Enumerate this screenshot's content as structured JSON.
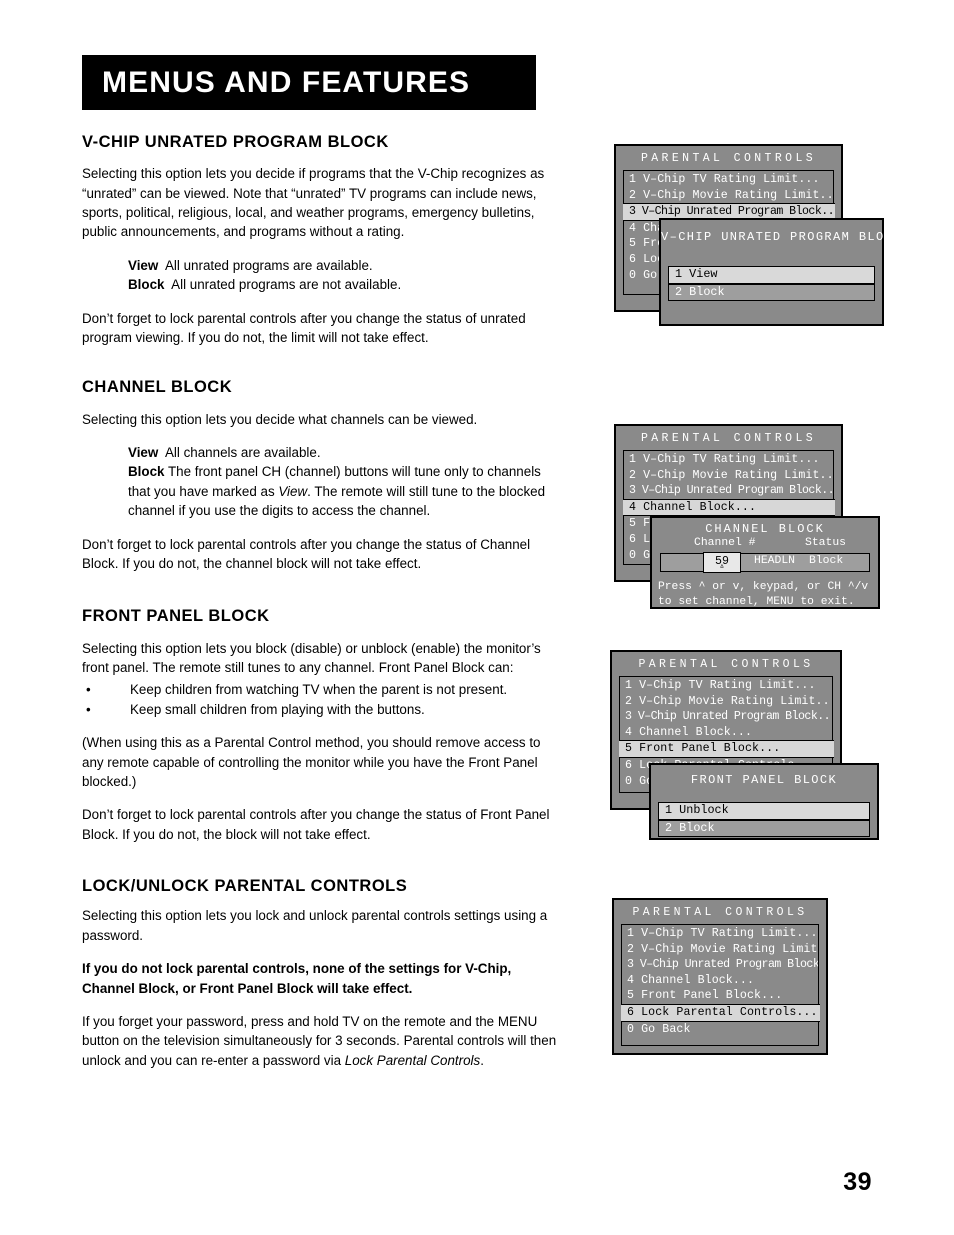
{
  "page": {
    "banner_title": "MENUS AND FEATURES",
    "page_number": "39"
  },
  "sections": [
    {
      "id": "vchip-unrated",
      "title": "V-CHIP UNRATED PROGRAM BLOCK",
      "p1": "Selecting this option lets you decide if programs that the V-Chip recognizes as “unrated” can be viewed. Note that “unrated” TV programs can include news, sports, political, religious, local, and weather programs, emergency bulletins, public announcements, and programs without a rating.",
      "view_lead": "View",
      "view_text": "All unrated programs are available.",
      "block_lead": "Block",
      "block_text": "All unrated programs are not available.",
      "p2": "Don’t forget to lock parental controls after you change the status of unrated program viewing. If you do not, the limit will not take effect."
    },
    {
      "id": "channel-block",
      "title": "CHANNEL BLOCK",
      "p1": "Selecting this option lets you decide what channels can be viewed.",
      "view_lead": "View",
      "view_text": "All channels are available.",
      "block_lead": "Block",
      "block_text_a": "The front panel CH (channel) buttons will tune only to channels that you have marked as ",
      "block_text_italic": "View",
      "block_text_b": ". The remote will still tune to the blocked channel if you use the digits to access the channel.",
      "p2": "Don’t forget to lock parental controls after you change the status of Channel Block. If you do not, the channel block will not take effect."
    },
    {
      "id": "front-panel-block",
      "title": "FRONT PANEL BLOCK",
      "p1": "Selecting this option lets you block (disable) or unblock (enable) the monitor’s front panel. The remote still tunes to any channel. Front Panel Block can:",
      "bullets": [
        "Keep children from watching TV when the parent is not present.",
        "Keep small children from playing with the buttons."
      ],
      "p2": "(When using this as a Parental Control method, you should remove access to any remote capable of controlling the monitor while you have the Front Panel blocked.)",
      "p3": "Don’t forget to lock parental controls after you change the status of Front Panel Block. If you do not, the block will not take effect."
    },
    {
      "id": "lock-unlock",
      "title": "LOCK/UNLOCK PARENTAL CONTROLS",
      "p1": "Selecting this option lets you lock and unlock parental controls settings using a password.",
      "p2_bold": "If you do not lock parental controls, none of the settings for V-Chip, Channel Block, or Front Panel Block will take effect.",
      "p3_a": "If you forget your password, press and hold TV on the remote and the MENU button on the television simultaneously for 3 seconds. Parental controls will then unlock and you can re-enter a password via ",
      "p3_italic": "Lock Parental Controls",
      "p3_b": "."
    }
  ],
  "osd": {
    "parental_controls_title": "PARENTAL CONTROLS",
    "menu_items": [
      "1 V–Chip TV Rating Limit...",
      "2 V–Chip Movie Rating Limit...",
      "3 V–Chip Unrated Program Block...",
      "4 Channel Block...",
      "5 Front Panel Block...",
      "6 Lock Parental Controls...",
      "0 Go Back"
    ],
    "figure1": {
      "selected_index": 2,
      "dialog_title": "V–CHIP UNRATED PROGRAM BLOCK",
      "options": [
        "1 View",
        "2 Block"
      ],
      "selected_option": 0
    },
    "figure2": {
      "selected_index": 3,
      "dialog_title": "CHANNEL BLOCK",
      "col_channel": "Channel #",
      "col_status": "Status",
      "channel_value": "59",
      "channel_name": "HEADLN",
      "channel_status": "Block",
      "help_line1": "Press ^ or v, keypad, or CH ^/v",
      "help_line2": "to set channel, MENU to exit."
    },
    "figure3": {
      "selected_index": 4,
      "dialog_title": "FRONT PANEL BLOCK",
      "options": [
        "1 Unblock",
        "2 Block"
      ],
      "selected_option": 0
    },
    "figure4": {
      "selected_index": 5
    }
  },
  "colors": {
    "osd_background": "#8a8a8a",
    "osd_row_light": "#9e9e9e",
    "osd_selected": "#d7d7d7",
    "banner_bg": "#000000"
  }
}
